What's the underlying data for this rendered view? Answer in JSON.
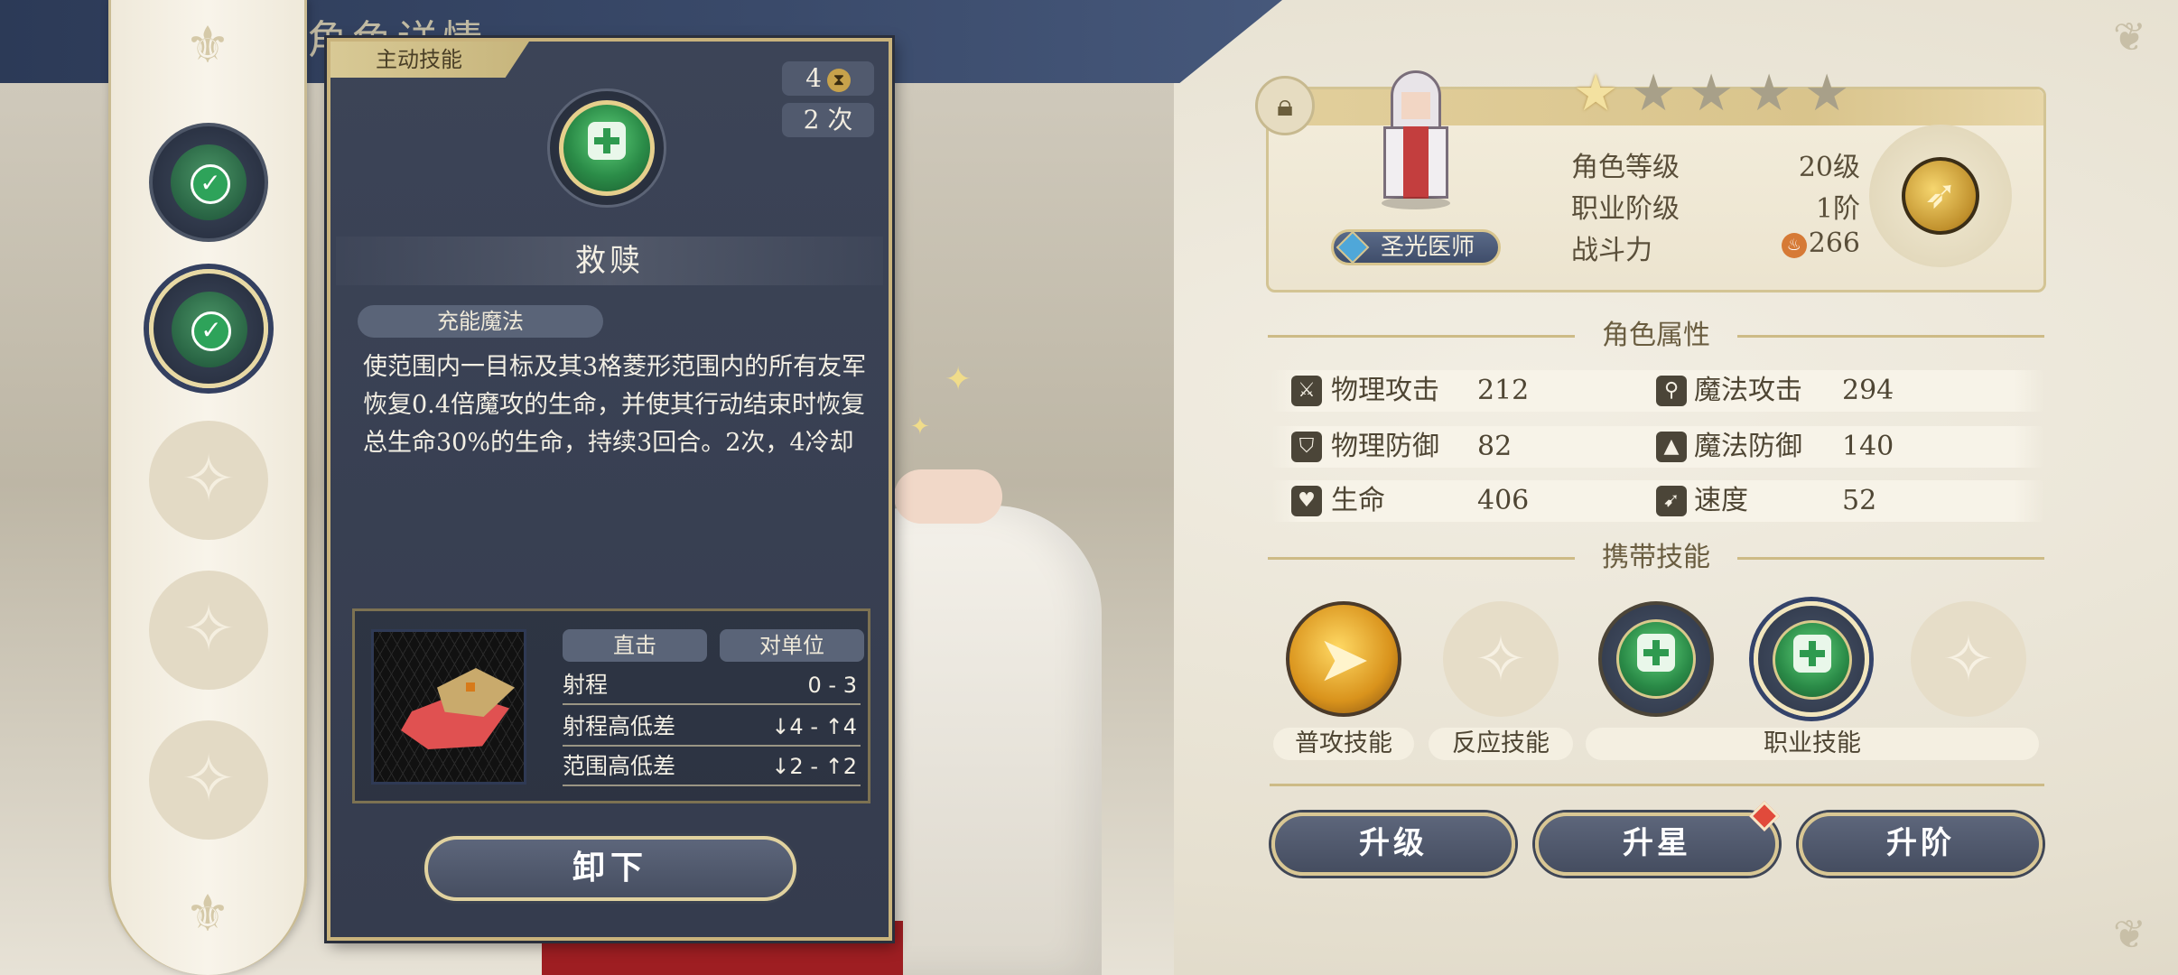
{
  "screen": {
    "title": "角色详情"
  },
  "slots": [
    {
      "state": "equipped",
      "icon": "heal-skill-icon"
    },
    {
      "state": "selected",
      "icon": "heal-skill-icon"
    },
    {
      "state": "empty",
      "icon": "empty-skill-slot-icon"
    },
    {
      "state": "empty",
      "icon": "empty-skill-slot-icon"
    },
    {
      "state": "empty",
      "icon": "empty-skill-slot-icon"
    }
  ],
  "skill_panel": {
    "type_label": "主动技能",
    "cooldown": "4",
    "uses": "2 次",
    "name": "救赎",
    "tag": "充能魔法",
    "description": "使范围内一目标及其3格菱形范围内的所有友军恢复0.4倍魔攻的生命，并使其行动结束时恢复总生命30%的生命，持续3回合。2次，4冷却",
    "attack_type": "直击",
    "target_type": "对单位",
    "range_rows": [
      {
        "label": "射程",
        "value": "0 - 3"
      },
      {
        "label": "射程高低差",
        "value": "↓4 - ↑4"
      },
      {
        "label": "范围高低差",
        "value": "↓2 - ↑2"
      }
    ],
    "unequip_label": "卸下"
  },
  "character": {
    "stars_filled": 1,
    "stars_total": 5,
    "class_name": "圣光医师",
    "stats": [
      {
        "label": "角色等级",
        "value": "20级"
      },
      {
        "label": "职业阶级",
        "value": "1阶"
      },
      {
        "label": "战斗力",
        "value": "266"
      }
    ]
  },
  "attributes": {
    "header": "角色属性",
    "items": [
      {
        "icon": "sword-icon",
        "name": "物理攻击",
        "value": "212"
      },
      {
        "icon": "wand-icon",
        "name": "魔法攻击",
        "value": "294"
      },
      {
        "icon": "shield-icon",
        "name": "物理防御",
        "value": "82"
      },
      {
        "icon": "hat-icon",
        "name": "魔法防御",
        "value": "140"
      },
      {
        "icon": "heart-icon",
        "name": "生命",
        "value": "406"
      },
      {
        "icon": "wing-icon",
        "name": "速度",
        "value": "52"
      }
    ]
  },
  "carried_skills": {
    "header": "携带技能",
    "labels": [
      "普攻技能",
      "反应技能",
      "职业技能"
    ]
  },
  "actions": {
    "level_up": "升级",
    "star_up": "升星",
    "rank_up": "升阶"
  },
  "colors": {
    "panel_bg": "#3a4255",
    "gold_border": "#c9b37c",
    "heal_green": "#2e9a4f",
    "badge_red": "#e14a3b"
  }
}
